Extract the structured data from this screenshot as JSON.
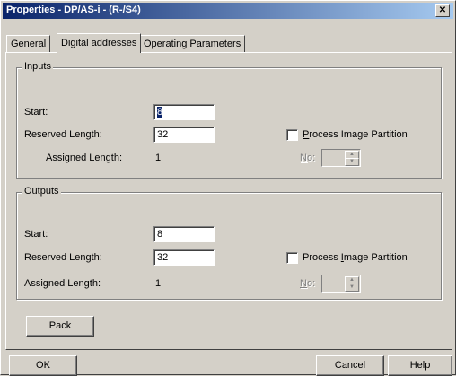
{
  "window": {
    "title": "Properties - DP/AS-i - (R-/S4)",
    "close_glyph": "✕"
  },
  "tabs": [
    {
      "label": "General"
    },
    {
      "label": "Digital addresses"
    },
    {
      "label": "Operating Parameters"
    }
  ],
  "inputs": {
    "group_title": "Inputs",
    "start_label": "Start:",
    "start_value": "8",
    "reserved_label": "Reserved Length:",
    "reserved_value": "32",
    "assigned_label": "Assigned Length:",
    "assigned_value": "1",
    "pip_label_pre": "",
    "pip_label_ul": "P",
    "pip_label_post": "rocess Image Partition",
    "no_label_ul": "N",
    "no_label_post": "o:"
  },
  "outputs": {
    "group_title": "Outputs",
    "start_label": "Start:",
    "start_value": "8",
    "reserved_label": "Reserved Length:",
    "reserved_value": "32",
    "assigned_label": "Assigned Length:",
    "assigned_value": "1",
    "pip_label_pre": "Process ",
    "pip_label_ul": "I",
    "pip_label_post": "mage Partition",
    "no_label_ul": "N",
    "no_label_post": "o:"
  },
  "buttons": {
    "pack": "Pack",
    "ok": "OK",
    "cancel": "Cancel",
    "help": "Help"
  }
}
